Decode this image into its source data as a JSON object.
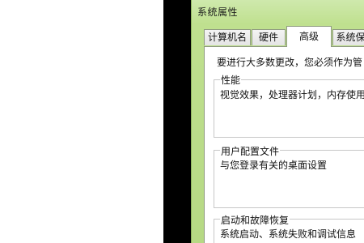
{
  "window": {
    "title": "系统属性"
  },
  "tabs": [
    {
      "label": "计算机名",
      "active": false
    },
    {
      "label": "硬件",
      "active": false
    },
    {
      "label": "高级",
      "active": true
    },
    {
      "label": "系统保",
      "active": false
    }
  ],
  "advanced": {
    "notice": "要进行大多数更改，您必须作为管",
    "performance": {
      "title": "性能",
      "description": "视觉效果，处理器计划，内存使用"
    },
    "user_profiles": {
      "title": "用户配置文件",
      "description": "与您登录有关的桌面设置"
    },
    "startup_recovery": {
      "title": "启动和故障恢复",
      "description": "系统启动、系统失败和调试信息"
    }
  }
}
